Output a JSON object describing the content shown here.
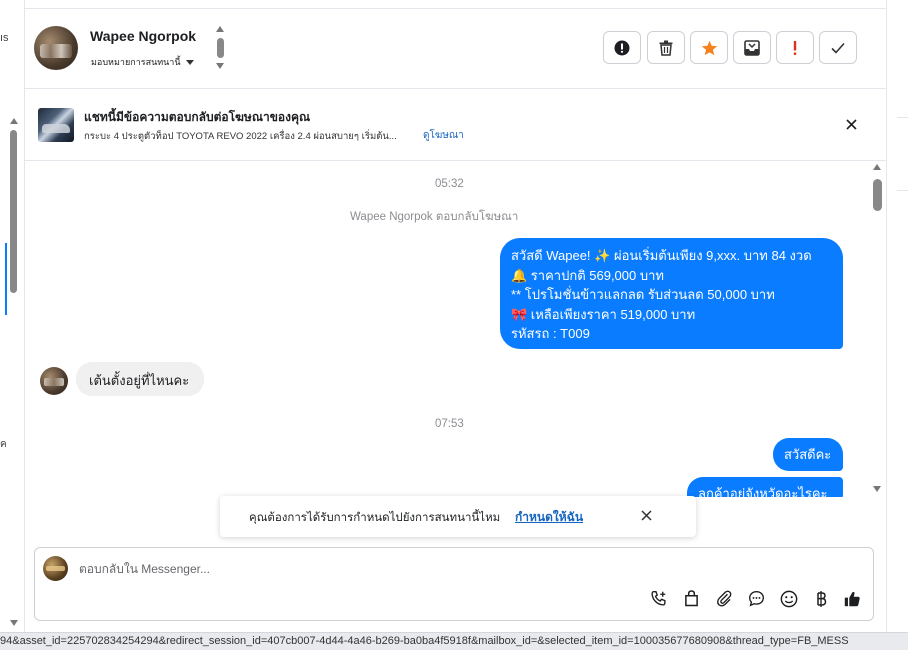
{
  "header": {
    "contact_name": "Wapee Ngorpok",
    "assign_label": "มอบหมายการสนทนานี้"
  },
  "ad_banner": {
    "title": "แชทนี้มีข้อความตอบกลับต่อโฆษณาของคุณ",
    "description": "กระบะ 4 ประตูตัวท็อป TOYOTA REVO 2022 เครื่อง 2.4 ผ่อนสบายๆ เริ่มต้น...",
    "link_label": "ดูโฆษณา"
  },
  "conversation": {
    "timestamp_1": "05:32",
    "reply_note": "Wapee Ngorpok ตอบกลับโฆษณา",
    "message_1_lines": [
      "สวัสดี Wapee! ✨  ผ่อนเริ่มต้นเพียง 9,xxx. บาท 84 งวด",
      "🔔 ราคาปกติ 569,000 บาท",
      "** โปรโมชั่นข้าวแลกลด รับส่วนลด 50,000 บาท",
      "🎀  เหลือเพียงราคา 519,000 บาท",
      " รหัสรถ : T009"
    ],
    "message_2": "เต้นตั้งอยู่ที่ไหนคะ",
    "timestamp_2": "07:53",
    "message_3": "สวัสดีคะ",
    "message_4": "ลูกค้าอยู่จังหวัดอะไรคะ"
  },
  "toast": {
    "text": "คุณต้องการได้รับการกำหนดไปยังการสนทนานี้ไหม",
    "link_label": "กำหนดให้ฉัน"
  },
  "composer": {
    "placeholder": "ตอบกลับใน Messenger..."
  },
  "left_strip": {
    "fragment_1": "ıs",
    "fragment_2": "ค"
  },
  "status_bar": {
    "url_text": "94&asset_id=225702834254294&redirect_session_id=407cb007-4d44-4a46-b269-ba0ba4f5918f&mailbox_id=&selected_item_id=100035677680908&thread_type=FB_MESS"
  },
  "colors": {
    "accent": "#0a7cff",
    "star": "#f5821f",
    "alert": "#e02f1f",
    "link": "#1565c0"
  },
  "icons": {
    "header_buttons": [
      "info-circle-icon",
      "trash-icon",
      "star-icon",
      "archive-icon",
      "exclamation-icon",
      "checkmark-icon"
    ],
    "composer_tools": [
      "phone-plus-icon",
      "shopping-bag-icon",
      "paperclip-icon",
      "chat-bubble-icon",
      "emoji-icon",
      "baht-icon",
      "thumbs-up-icon"
    ]
  }
}
